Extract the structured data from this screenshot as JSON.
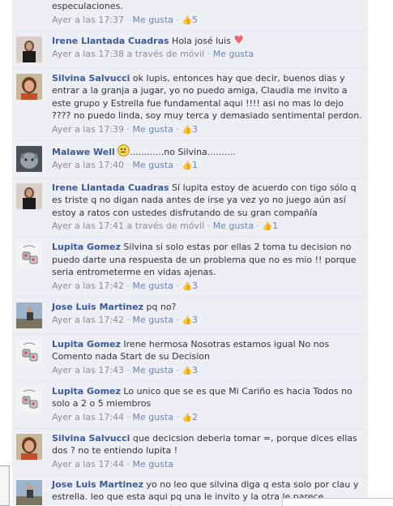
{
  "comments": [
    {
      "author": "",
      "text": "especulaciones.",
      "time": "Ayer a las 17:37",
      "via": "",
      "like": "Me gusta",
      "likes": "5",
      "emoji": ""
    },
    {
      "author": "Irene Llantada Cuadras",
      "text": "Hola josé luis",
      "time": "Ayer a las 17:38",
      "via": "a través de móvil",
      "like": "Me gusta",
      "likes": "",
      "emoji": "heart"
    },
    {
      "author": "Silvina Salvucci",
      "text": "ok lupis, entonces hay que decir, buenos dias y entrar a la granja a jugar, yo no puedo amiga, Claudia me invito a este grupo y Estrella fue fundamental aqui !!!! asi no mas lo dejo ???? no puedo linda, soy muy terca y demasiado sentimental perdon.",
      "time": "Ayer a las 17:39",
      "via": "",
      "like": "Me gusta",
      "likes": "3",
      "emoji": ""
    },
    {
      "author": "Malawe Well",
      "text": "............no Silvina..........",
      "time": "Ayer a las 17:40",
      "via": "",
      "like": "Me gusta",
      "likes": "1",
      "emoji": "smiley"
    },
    {
      "author": "Irene Llantada Cuadras",
      "text": "Sí lupita estoy de acuerdo con tigo sólo q es triste q no digan nada antes de irse ya vez yo no juego aún así estoy a ratos con ustedes disfrutando de su gran compañía",
      "time": "Ayer a las 17:41",
      "via": "a través de móvil",
      "like": "Me gusta",
      "likes": "1",
      "emoji": ""
    },
    {
      "author": "Lupita Gomez",
      "text": "Silvina si solo estas por ellas 2 toma tu decision no puedo darte una respuesta de un problema que no es mio !! porque seria entrometerme en vidas ajenas.",
      "time": "Ayer a las 17:42",
      "via": "",
      "like": "Me gusta",
      "likes": "3",
      "emoji": ""
    },
    {
      "author": "Jose Luis Martinez",
      "text": "pq no?",
      "time": "Ayer a las 17:42",
      "via": "",
      "like": "Me gusta",
      "likes": "3",
      "emoji": ""
    },
    {
      "author": "Lupita Gomez",
      "text": "Irene hermosa Nosotras estamos igual No nos Comento nada Start de su Decision",
      "time": "Ayer a las 17:43",
      "via": "",
      "like": "Me gusta",
      "likes": "3",
      "emoji": ""
    },
    {
      "author": "Lupita Gomez",
      "text": "Lo unico que se es que Mi Cariño es hacia Todos no solo a 2 o 5 miembros",
      "time": "Ayer a las 17:44",
      "via": "",
      "like": "Me gusta",
      "likes": "2",
      "emoji": ""
    },
    {
      "author": "Silvina Salvucci",
      "text": "que decicsion deberia tomar =, porque dices ellas dos ? no te entiendo lupita !",
      "time": "Ayer a las 17:44",
      "via": "",
      "like": "Me gusta",
      "likes": "",
      "emoji": ""
    },
    {
      "author": "Jose Luis Martinez",
      "text": "yo no leo que silvina diga q esta solo por clau y estrella. leo que esta aqui pq una le invito y la otra le parece fundamental.",
      "time": "",
      "via": "",
      "like": "",
      "likes": "",
      "emoji": ""
    }
  ],
  "colors": {
    "link": "#3b5998",
    "meta": "#8e8e8e",
    "action": "#6d84b4",
    "panel": "#edeff4",
    "divider": "#e2e5ec"
  },
  "icons": {
    "like_count": "thumbs-up-icon",
    "heart": "heart-emoji-icon",
    "smiley": "sad-face-emoji-icon"
  }
}
